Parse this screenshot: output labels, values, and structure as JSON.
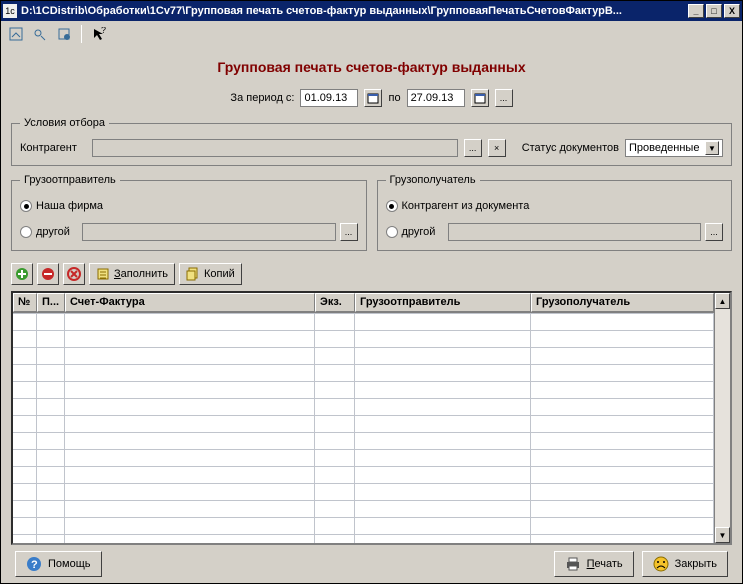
{
  "title": "D:\\1CDistrib\\Обработки\\1Cv77\\Групповая печать счетов-фактур выданных\\ГрупповаяПечатьСчетовФактурВ...",
  "page_title": "Групповая печать счетов-фактур выданных",
  "period": {
    "label_from": "За период с:",
    "date_from": "01.09.13",
    "label_to": "по",
    "date_to": "27.09.13",
    "ellipsis": "..."
  },
  "filter": {
    "legend": "Условия отбора",
    "counterparty_label": "Контрагент",
    "counterparty_value": "",
    "ellipsis": "...",
    "clear": "×",
    "status_label": "Статус документов",
    "status_value": "Проведенные"
  },
  "sender": {
    "legend": "Грузоотправитель",
    "opt1": "Наша фирма",
    "opt2": "другой",
    "other_value": ""
  },
  "receiver": {
    "legend": "Грузополучатель",
    "opt1": "Контрагент из документа",
    "opt2": "другой",
    "other_value": ""
  },
  "actions": {
    "fill": "Заполнить",
    "copies": "Копий"
  },
  "grid": {
    "cols": [
      "№",
      "П...",
      "Счет-Фактура",
      "Экз.",
      "Грузоотправитель",
      "Грузополучатель"
    ]
  },
  "footer": {
    "help": "Помощь",
    "print": "Печать",
    "close": "Закрыть"
  }
}
